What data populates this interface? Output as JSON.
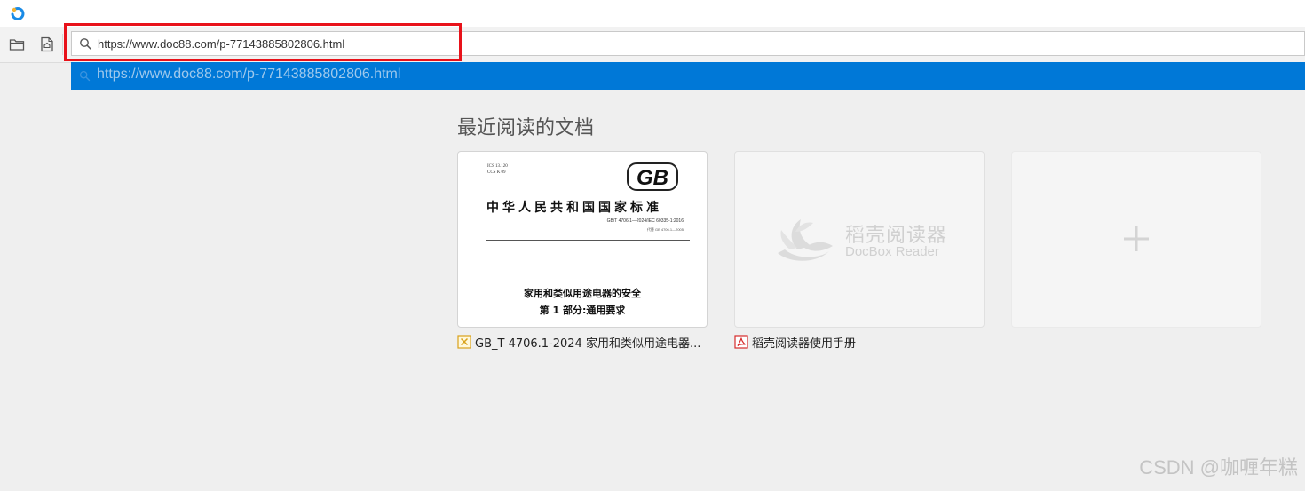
{
  "browser": {
    "address_value": "https://www.doc88.com/p-77143885802806.html",
    "address_placeholder": "",
    "suggestion": "https://www.doc88.com/p-77143885802806.html"
  },
  "recent": {
    "title": "最近阅读的文档",
    "cards": [
      {
        "caption": "GB_T 4706.1-2024 家用和类似用途电器...",
        "file_icon": "xps-file-icon",
        "thumbnail": {
          "codes": [
            "ICS 13.120",
            "CCS K 09"
          ],
          "logo": "GB",
          "heading": "中华人民共和国国家标准",
          "number": "GB/T 4706.1—2024/IEC 60335-1:2016",
          "replaces": "代替 GB 4706.1—2005",
          "doc_title": "家用和类似用途电器的安全",
          "doc_subtitle": "第 1 部分:通用要求"
        }
      },
      {
        "caption": "稻壳阅读器使用手册",
        "file_icon": "pdf-file-icon",
        "thumbnail": {
          "brand_cn": "稻壳阅读器",
          "brand_en": "DocBox Reader"
        }
      }
    ]
  },
  "watermark": "CSDN @咖喱年糕",
  "colors": {
    "accent": "#0078d7",
    "highlight": "#e8121a",
    "background": "#efefef"
  }
}
